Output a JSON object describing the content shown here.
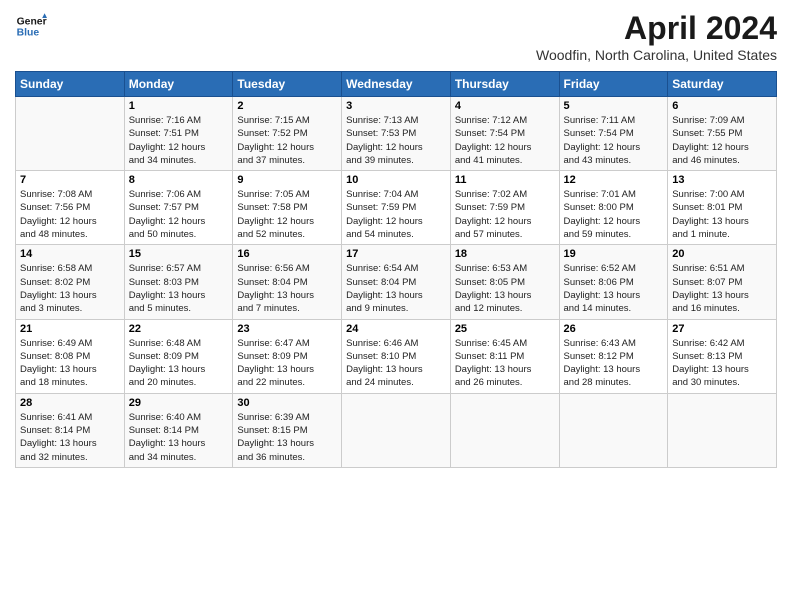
{
  "header": {
    "logo_line1": "General",
    "logo_line2": "Blue",
    "title": "April 2024",
    "subtitle": "Woodfin, North Carolina, United States"
  },
  "calendar": {
    "days_of_week": [
      "Sunday",
      "Monday",
      "Tuesday",
      "Wednesday",
      "Thursday",
      "Friday",
      "Saturday"
    ],
    "weeks": [
      [
        {
          "day": "",
          "info": ""
        },
        {
          "day": "1",
          "info": "Sunrise: 7:16 AM\nSunset: 7:51 PM\nDaylight: 12 hours\nand 34 minutes."
        },
        {
          "day": "2",
          "info": "Sunrise: 7:15 AM\nSunset: 7:52 PM\nDaylight: 12 hours\nand 37 minutes."
        },
        {
          "day": "3",
          "info": "Sunrise: 7:13 AM\nSunset: 7:53 PM\nDaylight: 12 hours\nand 39 minutes."
        },
        {
          "day": "4",
          "info": "Sunrise: 7:12 AM\nSunset: 7:54 PM\nDaylight: 12 hours\nand 41 minutes."
        },
        {
          "day": "5",
          "info": "Sunrise: 7:11 AM\nSunset: 7:54 PM\nDaylight: 12 hours\nand 43 minutes."
        },
        {
          "day": "6",
          "info": "Sunrise: 7:09 AM\nSunset: 7:55 PM\nDaylight: 12 hours\nand 46 minutes."
        }
      ],
      [
        {
          "day": "7",
          "info": "Sunrise: 7:08 AM\nSunset: 7:56 PM\nDaylight: 12 hours\nand 48 minutes."
        },
        {
          "day": "8",
          "info": "Sunrise: 7:06 AM\nSunset: 7:57 PM\nDaylight: 12 hours\nand 50 minutes."
        },
        {
          "day": "9",
          "info": "Sunrise: 7:05 AM\nSunset: 7:58 PM\nDaylight: 12 hours\nand 52 minutes."
        },
        {
          "day": "10",
          "info": "Sunrise: 7:04 AM\nSunset: 7:59 PM\nDaylight: 12 hours\nand 54 minutes."
        },
        {
          "day": "11",
          "info": "Sunrise: 7:02 AM\nSunset: 7:59 PM\nDaylight: 12 hours\nand 57 minutes."
        },
        {
          "day": "12",
          "info": "Sunrise: 7:01 AM\nSunset: 8:00 PM\nDaylight: 12 hours\nand 59 minutes."
        },
        {
          "day": "13",
          "info": "Sunrise: 7:00 AM\nSunset: 8:01 PM\nDaylight: 13 hours\nand 1 minute."
        }
      ],
      [
        {
          "day": "14",
          "info": "Sunrise: 6:58 AM\nSunset: 8:02 PM\nDaylight: 13 hours\nand 3 minutes."
        },
        {
          "day": "15",
          "info": "Sunrise: 6:57 AM\nSunset: 8:03 PM\nDaylight: 13 hours\nand 5 minutes."
        },
        {
          "day": "16",
          "info": "Sunrise: 6:56 AM\nSunset: 8:04 PM\nDaylight: 13 hours\nand 7 minutes."
        },
        {
          "day": "17",
          "info": "Sunrise: 6:54 AM\nSunset: 8:04 PM\nDaylight: 13 hours\nand 9 minutes."
        },
        {
          "day": "18",
          "info": "Sunrise: 6:53 AM\nSunset: 8:05 PM\nDaylight: 13 hours\nand 12 minutes."
        },
        {
          "day": "19",
          "info": "Sunrise: 6:52 AM\nSunset: 8:06 PM\nDaylight: 13 hours\nand 14 minutes."
        },
        {
          "day": "20",
          "info": "Sunrise: 6:51 AM\nSunset: 8:07 PM\nDaylight: 13 hours\nand 16 minutes."
        }
      ],
      [
        {
          "day": "21",
          "info": "Sunrise: 6:49 AM\nSunset: 8:08 PM\nDaylight: 13 hours\nand 18 minutes."
        },
        {
          "day": "22",
          "info": "Sunrise: 6:48 AM\nSunset: 8:09 PM\nDaylight: 13 hours\nand 20 minutes."
        },
        {
          "day": "23",
          "info": "Sunrise: 6:47 AM\nSunset: 8:09 PM\nDaylight: 13 hours\nand 22 minutes."
        },
        {
          "day": "24",
          "info": "Sunrise: 6:46 AM\nSunset: 8:10 PM\nDaylight: 13 hours\nand 24 minutes."
        },
        {
          "day": "25",
          "info": "Sunrise: 6:45 AM\nSunset: 8:11 PM\nDaylight: 13 hours\nand 26 minutes."
        },
        {
          "day": "26",
          "info": "Sunrise: 6:43 AM\nSunset: 8:12 PM\nDaylight: 13 hours\nand 28 minutes."
        },
        {
          "day": "27",
          "info": "Sunrise: 6:42 AM\nSunset: 8:13 PM\nDaylight: 13 hours\nand 30 minutes."
        }
      ],
      [
        {
          "day": "28",
          "info": "Sunrise: 6:41 AM\nSunset: 8:14 PM\nDaylight: 13 hours\nand 32 minutes."
        },
        {
          "day": "29",
          "info": "Sunrise: 6:40 AM\nSunset: 8:14 PM\nDaylight: 13 hours\nand 34 minutes."
        },
        {
          "day": "30",
          "info": "Sunrise: 6:39 AM\nSunset: 8:15 PM\nDaylight: 13 hours\nand 36 minutes."
        },
        {
          "day": "",
          "info": ""
        },
        {
          "day": "",
          "info": ""
        },
        {
          "day": "",
          "info": ""
        },
        {
          "day": "",
          "info": ""
        }
      ]
    ]
  }
}
